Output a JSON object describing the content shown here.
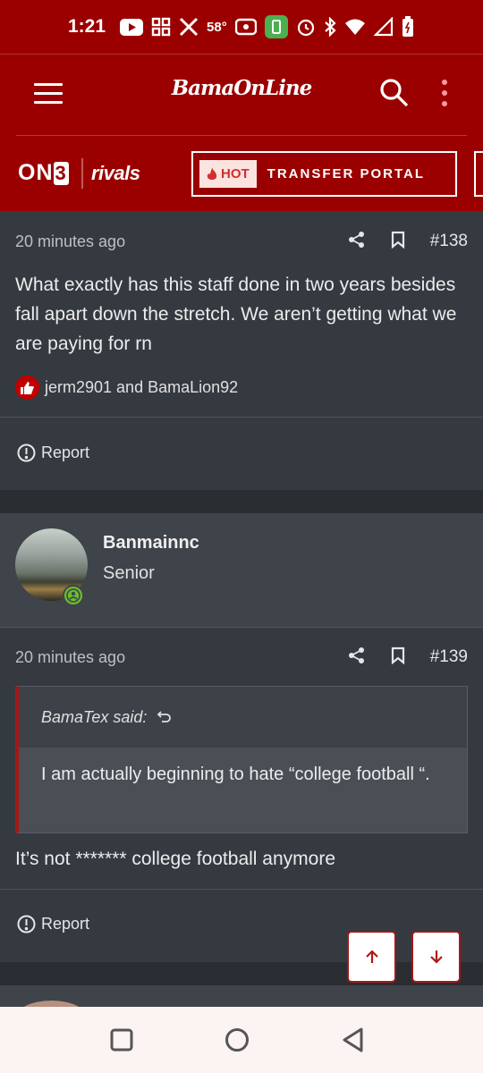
{
  "status_bar": {
    "time": "1:21",
    "temperature": "58°",
    "icons": [
      "youtube-icon",
      "apps-grid-icon",
      "x-logo-icon",
      "cast-icon",
      "battery-saver-icon",
      "alarm-icon",
      "bluetooth-icon",
      "wifi-icon",
      "signal-icon",
      "battery-icon"
    ]
  },
  "header": {
    "site_name": "BamaOnLine",
    "on3_logo": "ON3",
    "rivals_logo": "rivals",
    "hot_badge": "HOT",
    "portal_label": "TRANSFER PORTAL",
    "accent_color": "#9b0000"
  },
  "posts": [
    {
      "time": "20 minutes ago",
      "number": "#138",
      "body": "What exactly has this staff done in two years besides fall apart down the stretch. We aren’t getting what we are paying for rn",
      "reactions": "jerm2901 and BamaLion92",
      "report_label": "Report"
    },
    {
      "author": "Banmainnc",
      "rank": "Senior",
      "time": "20 minutes ago",
      "number": "#139",
      "quote_author": "BamaTex said:",
      "quote_text": "I am actually beginning to hate “college football “.",
      "body": "It’s not ******* college football anymore",
      "report_label": "Report"
    }
  ],
  "nav": {
    "scroll_up": "arrow-up-icon",
    "scroll_down": "arrow-down-icon"
  }
}
